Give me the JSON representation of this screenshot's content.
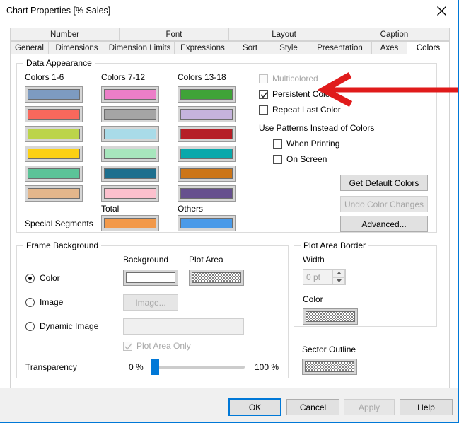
{
  "window": {
    "title": "Chart Properties [% Sales]",
    "close_icon": "close-icon",
    "accent_color": "#0078d7"
  },
  "tabs": {
    "row1": [
      {
        "label": "Number",
        "active": false
      },
      {
        "label": "Font",
        "active": false
      },
      {
        "label": "Layout",
        "active": false
      },
      {
        "label": "Caption",
        "active": false
      }
    ],
    "row2": [
      {
        "label": "General",
        "active": false
      },
      {
        "label": "Dimensions",
        "active": false
      },
      {
        "label": "Dimension Limits",
        "active": false
      },
      {
        "label": "Expressions",
        "active": false
      },
      {
        "label": "Sort",
        "active": false
      },
      {
        "label": "Style",
        "active": false
      },
      {
        "label": "Presentation",
        "active": false
      },
      {
        "label": "Axes",
        "active": false
      },
      {
        "label": "Colors",
        "active": true
      }
    ]
  },
  "data_appearance": {
    "group_label": "Data Appearance",
    "col1_header": "Colors 1-6",
    "col2_header": "Colors 7-12",
    "col3_header": "Colors 13-18",
    "colors_1_6": [
      "#7d9bc1",
      "#f9685c",
      "#bcd44a",
      "#fbd014",
      "#5cc398",
      "#e3b68b"
    ],
    "colors_7_12": [
      "#ec7ec8",
      "#a5a5a5",
      "#a9dbe8",
      "#a7e6bd",
      "#1d6f8e",
      "#fbc0cd"
    ],
    "colors_13_18": [
      "#3fa338",
      "#c5b3dd",
      "#b51f27",
      "#09a8ab",
      "#cc7518",
      "#66508e"
    ],
    "special_segments_label": "Special Segments",
    "total_label": "Total",
    "total_color": "#f2994a",
    "others_label": "Others",
    "others_color": "#4a9ae8"
  },
  "options": {
    "multicolored": {
      "label": "Multicolored",
      "checked": false,
      "enabled": false
    },
    "persistent_colors": {
      "label": "Persistent Colors",
      "checked": true,
      "enabled": true
    },
    "repeat_last_color": {
      "label": "Repeat Last Color",
      "checked": false,
      "enabled": true
    },
    "patterns_heading": "Use Patterns Instead of Colors",
    "when_printing": {
      "label": "When Printing",
      "checked": false,
      "enabled": true
    },
    "on_screen": {
      "label": "On Screen",
      "checked": false,
      "enabled": true
    },
    "get_default_colors": {
      "label": "Get Default Colors",
      "enabled": true
    },
    "undo_color_changes": {
      "label": "Undo Color Changes",
      "enabled": false
    },
    "advanced": {
      "label": "Advanced...",
      "enabled": true
    }
  },
  "frame_background": {
    "group_label": "Frame Background",
    "background_header": "Background",
    "plot_area_header": "Plot Area",
    "radio_color": {
      "label": "Color",
      "selected": true
    },
    "radio_image": {
      "label": "Image",
      "selected": false
    },
    "radio_dynamic_image": {
      "label": "Dynamic Image",
      "selected": false
    },
    "background_swatch_color": "#ffffff",
    "plot_area_swatch": "checkered",
    "image_button": {
      "label": "Image...",
      "enabled": false
    },
    "dynamic_image_value": "",
    "plot_area_only": {
      "label": "Plot Area Only",
      "checked": true,
      "enabled": false
    },
    "transparency_label": "Transparency",
    "transparency_min": "0 %",
    "transparency_max": "100 %",
    "transparency_value": 0
  },
  "plot_area_border": {
    "group_label": "Plot Area Border",
    "width_label": "Width",
    "width_value": "0 pt",
    "width_enabled": false,
    "color_label": "Color",
    "color_swatch": "checkered",
    "spin_up_icon": "chevron-up-icon",
    "spin_down_icon": "chevron-down-icon"
  },
  "sector_outline": {
    "label": "Sector Outline",
    "swatch": "checkered"
  },
  "footer": {
    "ok": {
      "label": "OK",
      "default": true
    },
    "cancel": {
      "label": "Cancel",
      "enabled": true
    },
    "apply": {
      "label": "Apply",
      "enabled": false
    },
    "help": {
      "label": "Help",
      "enabled": true
    }
  },
  "annotation": {
    "type": "red-arrow",
    "color": "#e01b1b",
    "points_at": "Persistent Colors"
  }
}
